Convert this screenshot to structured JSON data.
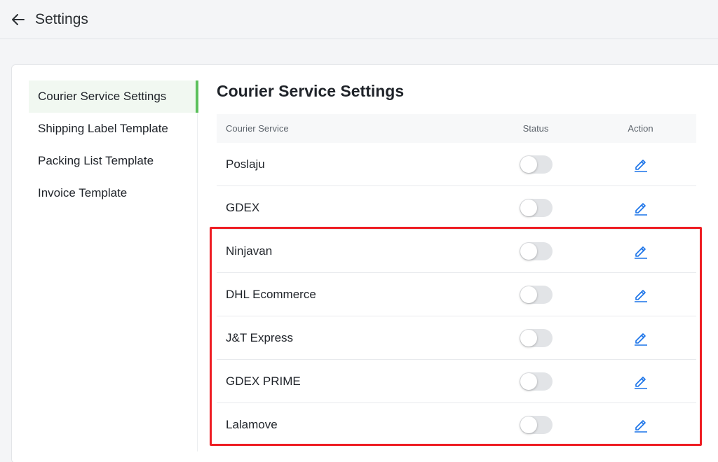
{
  "header": {
    "title": "Settings",
    "back_icon": "arrow-left-icon"
  },
  "sidebar": {
    "items": [
      {
        "label": "Courier Service Settings",
        "active": true
      },
      {
        "label": "Shipping Label Template",
        "active": false
      },
      {
        "label": "Packing List Template",
        "active": false
      },
      {
        "label": "Invoice Template",
        "active": false
      }
    ],
    "active_color": "#5cc05c"
  },
  "main": {
    "title": "Courier Service Settings",
    "table": {
      "columns": [
        "Courier Service",
        "Status",
        "Action"
      ],
      "rows": [
        {
          "name": "Poslaju",
          "status": "off",
          "action_icon": "edit-icon"
        },
        {
          "name": "GDEX",
          "status": "off",
          "action_icon": "edit-icon"
        },
        {
          "name": "Ninjavan",
          "status": "off",
          "action_icon": "edit-icon"
        },
        {
          "name": "DHL Ecommerce",
          "status": "off",
          "action_icon": "edit-icon"
        },
        {
          "name": "J&T Express",
          "status": "off",
          "action_icon": "edit-icon"
        },
        {
          "name": "GDEX PRIME",
          "status": "off",
          "action_icon": "edit-icon"
        },
        {
          "name": "Lalamove",
          "status": "off",
          "action_icon": "edit-icon"
        }
      ]
    }
  },
  "colors": {
    "accent": "#1a73e8",
    "highlight": "#ee1d23"
  }
}
